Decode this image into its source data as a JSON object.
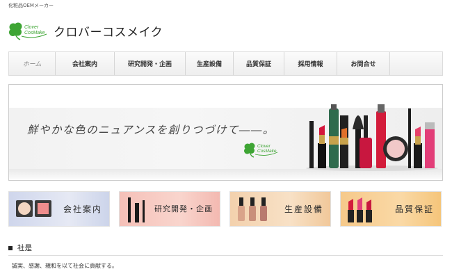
{
  "header": {
    "tagline": "化粧品OEMメーカー",
    "logo_mark_text": [
      "Clover",
      "CosMake"
    ],
    "logo_name": "クロバーコスメイク"
  },
  "nav": {
    "items": [
      {
        "label": "ホーム",
        "active": true
      },
      {
        "label": "会社案内"
      },
      {
        "label": "研究開発・企画"
      },
      {
        "label": "生産設備"
      },
      {
        "label": "品質保証"
      },
      {
        "label": "採用情報"
      },
      {
        "label": "お問合せ"
      }
    ]
  },
  "hero": {
    "catch_copy": "鮮やかな色のニュアンスを創りつづけて――。",
    "logo_text": [
      "Clover",
      "CosMake"
    ]
  },
  "cards": [
    {
      "label": "会社案内",
      "icon": "compact-powder-icon",
      "bg": "#ccd4ea"
    },
    {
      "label": "研究開発・企画",
      "icon": "mascara-icon",
      "bg": "#f3b9b1"
    },
    {
      "label": "生産設備",
      "icon": "nail-polish-icon",
      "bg": "#f1c89a"
    },
    {
      "label": "品質保証",
      "icon": "lipstick-icon",
      "bg": "#f5c57a"
    }
  ],
  "section": {
    "title": "社是",
    "text": "誠実、感謝、親和を以て社会に貢献する。"
  },
  "colors": {
    "clover_green": "#3ea534",
    "accent_text": "#333333"
  }
}
